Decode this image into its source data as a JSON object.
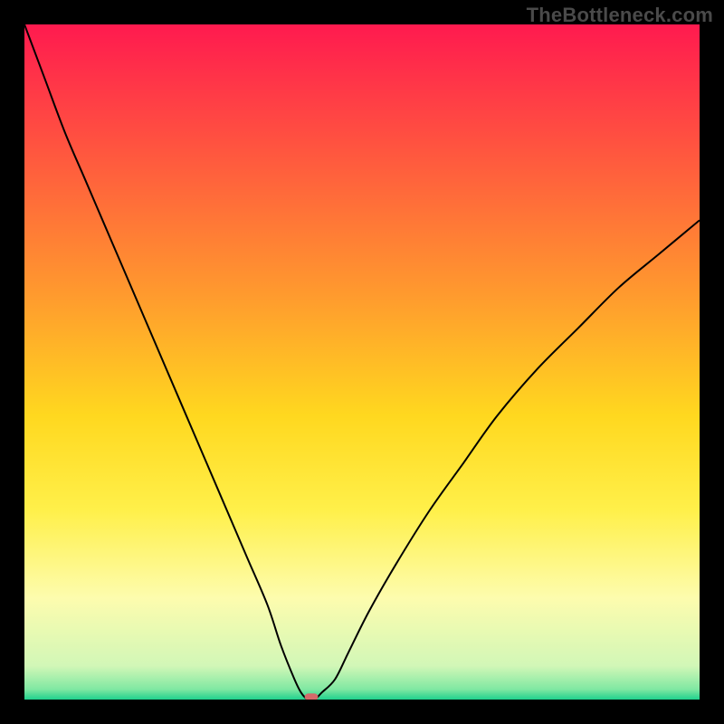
{
  "watermark": "TheBottleneck.com",
  "chart_data": {
    "type": "line",
    "title": "",
    "xlabel": "",
    "ylabel": "",
    "xlim": [
      0,
      100
    ],
    "ylim": [
      0,
      100
    ],
    "grid": false,
    "axes_visible": false,
    "background_gradient_stops": [
      {
        "offset": 0.0,
        "color": "#ff1a4f"
      },
      {
        "offset": 0.2,
        "color": "#ff5a3e"
      },
      {
        "offset": 0.4,
        "color": "#ff9a2e"
      },
      {
        "offset": 0.58,
        "color": "#ffd81f"
      },
      {
        "offset": 0.72,
        "color": "#fff04a"
      },
      {
        "offset": 0.85,
        "color": "#fdfcae"
      },
      {
        "offset": 0.95,
        "color": "#d2f7b7"
      },
      {
        "offset": 0.985,
        "color": "#7fe8a2"
      },
      {
        "offset": 1.0,
        "color": "#1fd18d"
      }
    ],
    "series": [
      {
        "name": "bottleneck-curve",
        "color": "#000000",
        "stroke_width": 2,
        "x": [
          0,
          3,
          6,
          9,
          12,
          15,
          18,
          21,
          24,
          27,
          30,
          33,
          36,
          38,
          40,
          41,
          42,
          43,
          44,
          46,
          48,
          51,
          55,
          60,
          65,
          70,
          76,
          82,
          88,
          94,
          100
        ],
        "y": [
          100,
          92,
          84,
          77,
          70,
          63,
          56,
          49,
          42,
          35,
          28,
          21,
          14,
          8,
          3,
          1,
          0,
          0,
          1,
          3,
          7,
          13,
          20,
          28,
          35,
          42,
          49,
          55,
          61,
          66,
          71
        ]
      }
    ],
    "marker": {
      "name": "bottleneck-marker",
      "x": 42.5,
      "y": 0.4,
      "width": 2.0,
      "height": 1.0,
      "rx": 0.6,
      "fill": "#d46a6a"
    }
  }
}
